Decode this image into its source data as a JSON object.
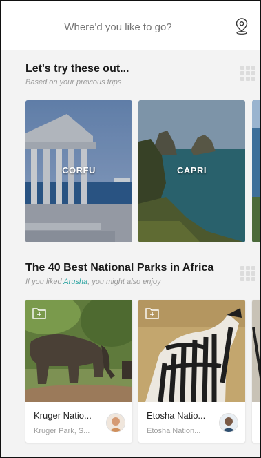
{
  "search": {
    "placeholder": "Where'd you like to go?",
    "value": ""
  },
  "section1": {
    "title": "Let's try these out...",
    "subtitle": "Based on your previous trips",
    "cards": [
      {
        "label": "CORFU"
      },
      {
        "label": "CAPRI"
      }
    ]
  },
  "section2": {
    "title": "The 40 Best National Parks in Africa",
    "subtitle_prefix": "If you liked ",
    "subtitle_highlight": "Arusha",
    "subtitle_suffix": ", you might also enjoy",
    "cards": [
      {
        "name": "Kruger Natio...",
        "location": "Kruger Park, S..."
      },
      {
        "name": "Etosha Natio...",
        "location": "Etosha Nation..."
      }
    ]
  },
  "colors": {
    "accent": "#2aa3a0",
    "background": "#f3f3f3"
  },
  "icons": {
    "location": "map-pin-icon",
    "grid": "grid-icon",
    "save": "add-to-folder-icon"
  }
}
